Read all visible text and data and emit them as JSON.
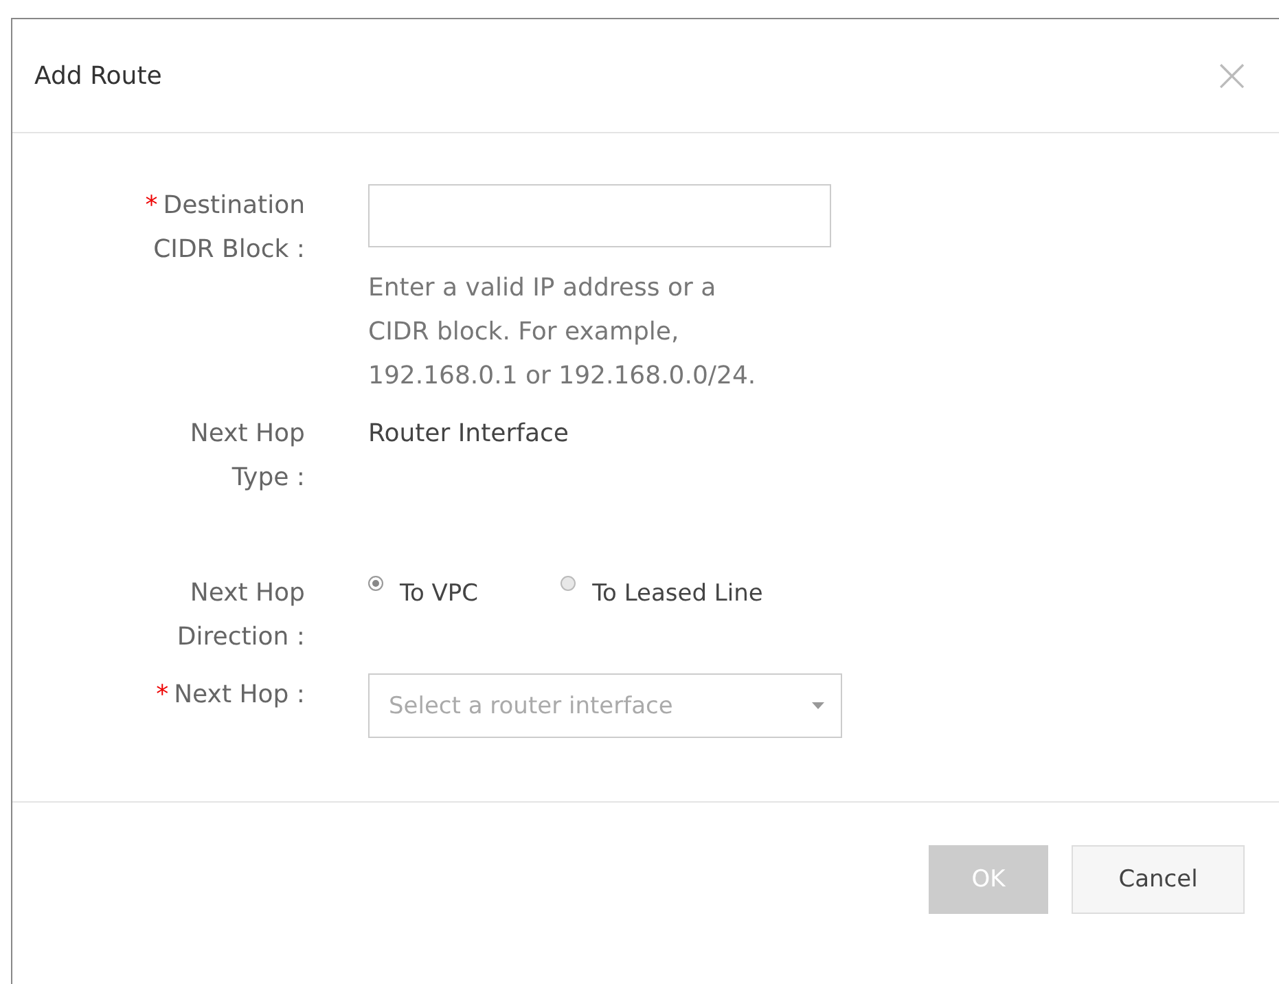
{
  "dialog": {
    "title": "Add Route",
    "close": "×"
  },
  "fields": [
    {
      "kind": "input",
      "label": "Destination CIDR Block :",
      "required_mark": "*",
      "help": "Enter a valid IP address or a CIDR block. For example, 192.168.0.1 or 192.168.0.0/24."
    },
    {
      "kind": "text",
      "label": "Next Hop Type :",
      "text": "Router Interface"
    },
    {
      "kind": "radio",
      "label": "Next Hop Direction :",
      "options": [
        {
          "label": "To VPC",
          "selected": true
        },
        {
          "label": "To Leased Line",
          "selected": false
        }
      ]
    },
    {
      "kind": "select",
      "label": "Next Hop :",
      "required_mark": "*",
      "placeholder": "Select a router interface"
    }
  ],
  "buttons": [
    {
      "label": "OK",
      "kind": "primary",
      "disabled": true
    },
    {
      "label": "Cancel",
      "kind": "default",
      "disabled": false
    }
  ]
}
